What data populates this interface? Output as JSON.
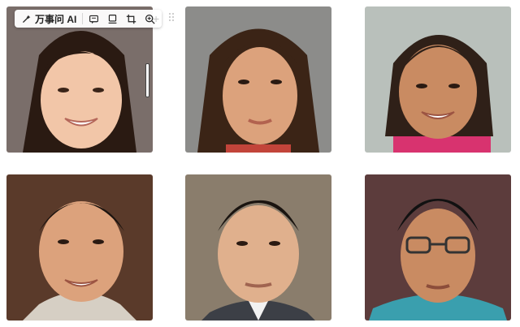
{
  "toolbar": {
    "ai_label": "万事问 AI",
    "buttons": [
      "magic-ai-icon",
      "comment-icon",
      "display-icon",
      "crop-icon",
      "zoom-in-icon"
    ]
  },
  "colors": {
    "skin_light": "#f2c6a8",
    "skin_mid": "#dca27c",
    "skin_tan": "#c98b62",
    "hair_dark": "#2a1a12",
    "pink_shirt": "#d8336f",
    "teal_shirt": "#3a9fae"
  }
}
